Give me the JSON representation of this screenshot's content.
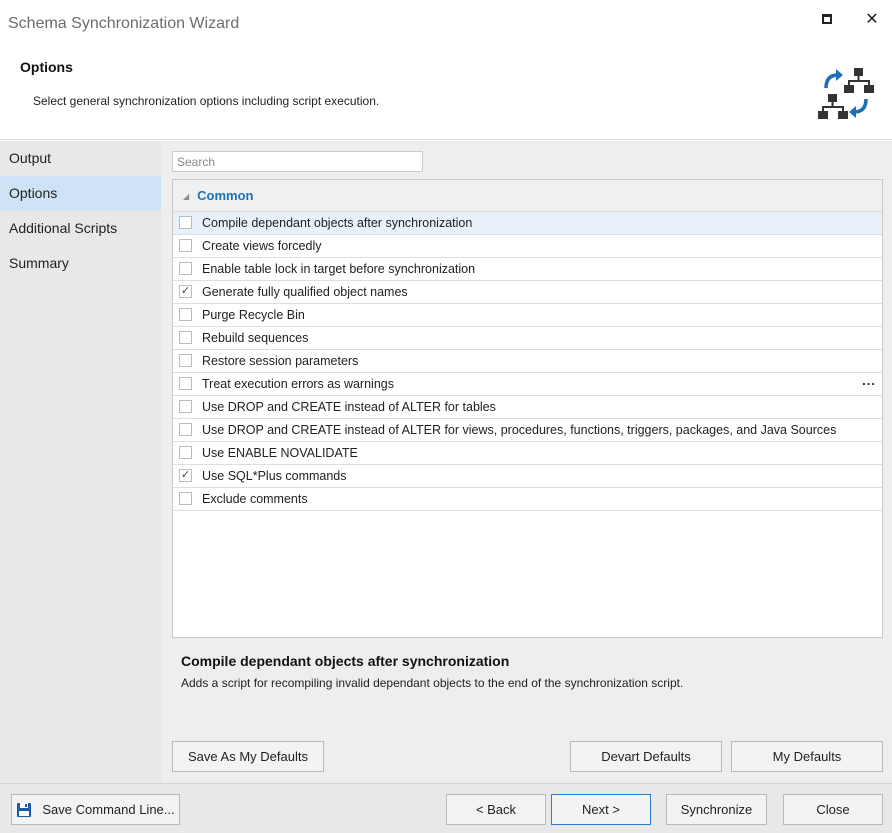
{
  "window": {
    "title": "Schema Synchronization Wizard",
    "maximize_icon": "maximize-icon",
    "close_glyph": "✕"
  },
  "header": {
    "title": "Options",
    "subtitle": "Select general synchronization options including script execution.",
    "icon": "schema-sync-icon"
  },
  "sidebar": {
    "items": [
      {
        "label": "Output",
        "active": false
      },
      {
        "label": "Options",
        "active": true
      },
      {
        "label": "Additional Scripts",
        "active": false
      },
      {
        "label": "Summary",
        "active": false
      }
    ]
  },
  "search": {
    "placeholder": "Search",
    "value": ""
  },
  "options": {
    "group_label": "Common",
    "items": [
      {
        "label": "Compile dependant objects after synchronization",
        "checked": false,
        "selected": true
      },
      {
        "label": "Create views forcedly",
        "checked": false
      },
      {
        "label": "Enable table lock in target before synchronization",
        "checked": false
      },
      {
        "label": "Generate fully qualified object names",
        "checked": true
      },
      {
        "label": "Purge Recycle Bin",
        "checked": false
      },
      {
        "label": "Rebuild sequences",
        "checked": false
      },
      {
        "label": "Restore session parameters",
        "checked": false
      },
      {
        "label": "Treat execution errors as warnings",
        "checked": false,
        "has_ellipsis": true
      },
      {
        "label": "Use DROP and CREATE instead of ALTER for tables",
        "checked": false
      },
      {
        "label": "Use DROP and CREATE instead of ALTER for views, procedures, functions, triggers, packages, and Java Sources",
        "checked": false
      },
      {
        "label": "Use ENABLE NOVALIDATE",
        "checked": false
      },
      {
        "label": "Use SQL*Plus commands",
        "checked": true
      },
      {
        "label": "Exclude comments",
        "checked": false
      }
    ],
    "ellipsis": "..."
  },
  "description": {
    "title": "Compile dependant objects after synchronization",
    "text": "Adds a script for recompiling invalid dependant objects to the end of the synchronization script."
  },
  "defaults_buttons": {
    "save_as_my_defaults": "Save As My Defaults",
    "devart_defaults": "Devart Defaults",
    "my_defaults": "My Defaults"
  },
  "footer": {
    "save_command_line": "Save Command Line...",
    "back": "< Back",
    "next": "Next >",
    "synchronize": "Synchronize",
    "close": "Close"
  },
  "colors": {
    "accent": "#1a73b8",
    "nav_active": "#cfe3f7",
    "selected_row": "#e8f0fa",
    "primary_border": "#2b7cd3"
  }
}
